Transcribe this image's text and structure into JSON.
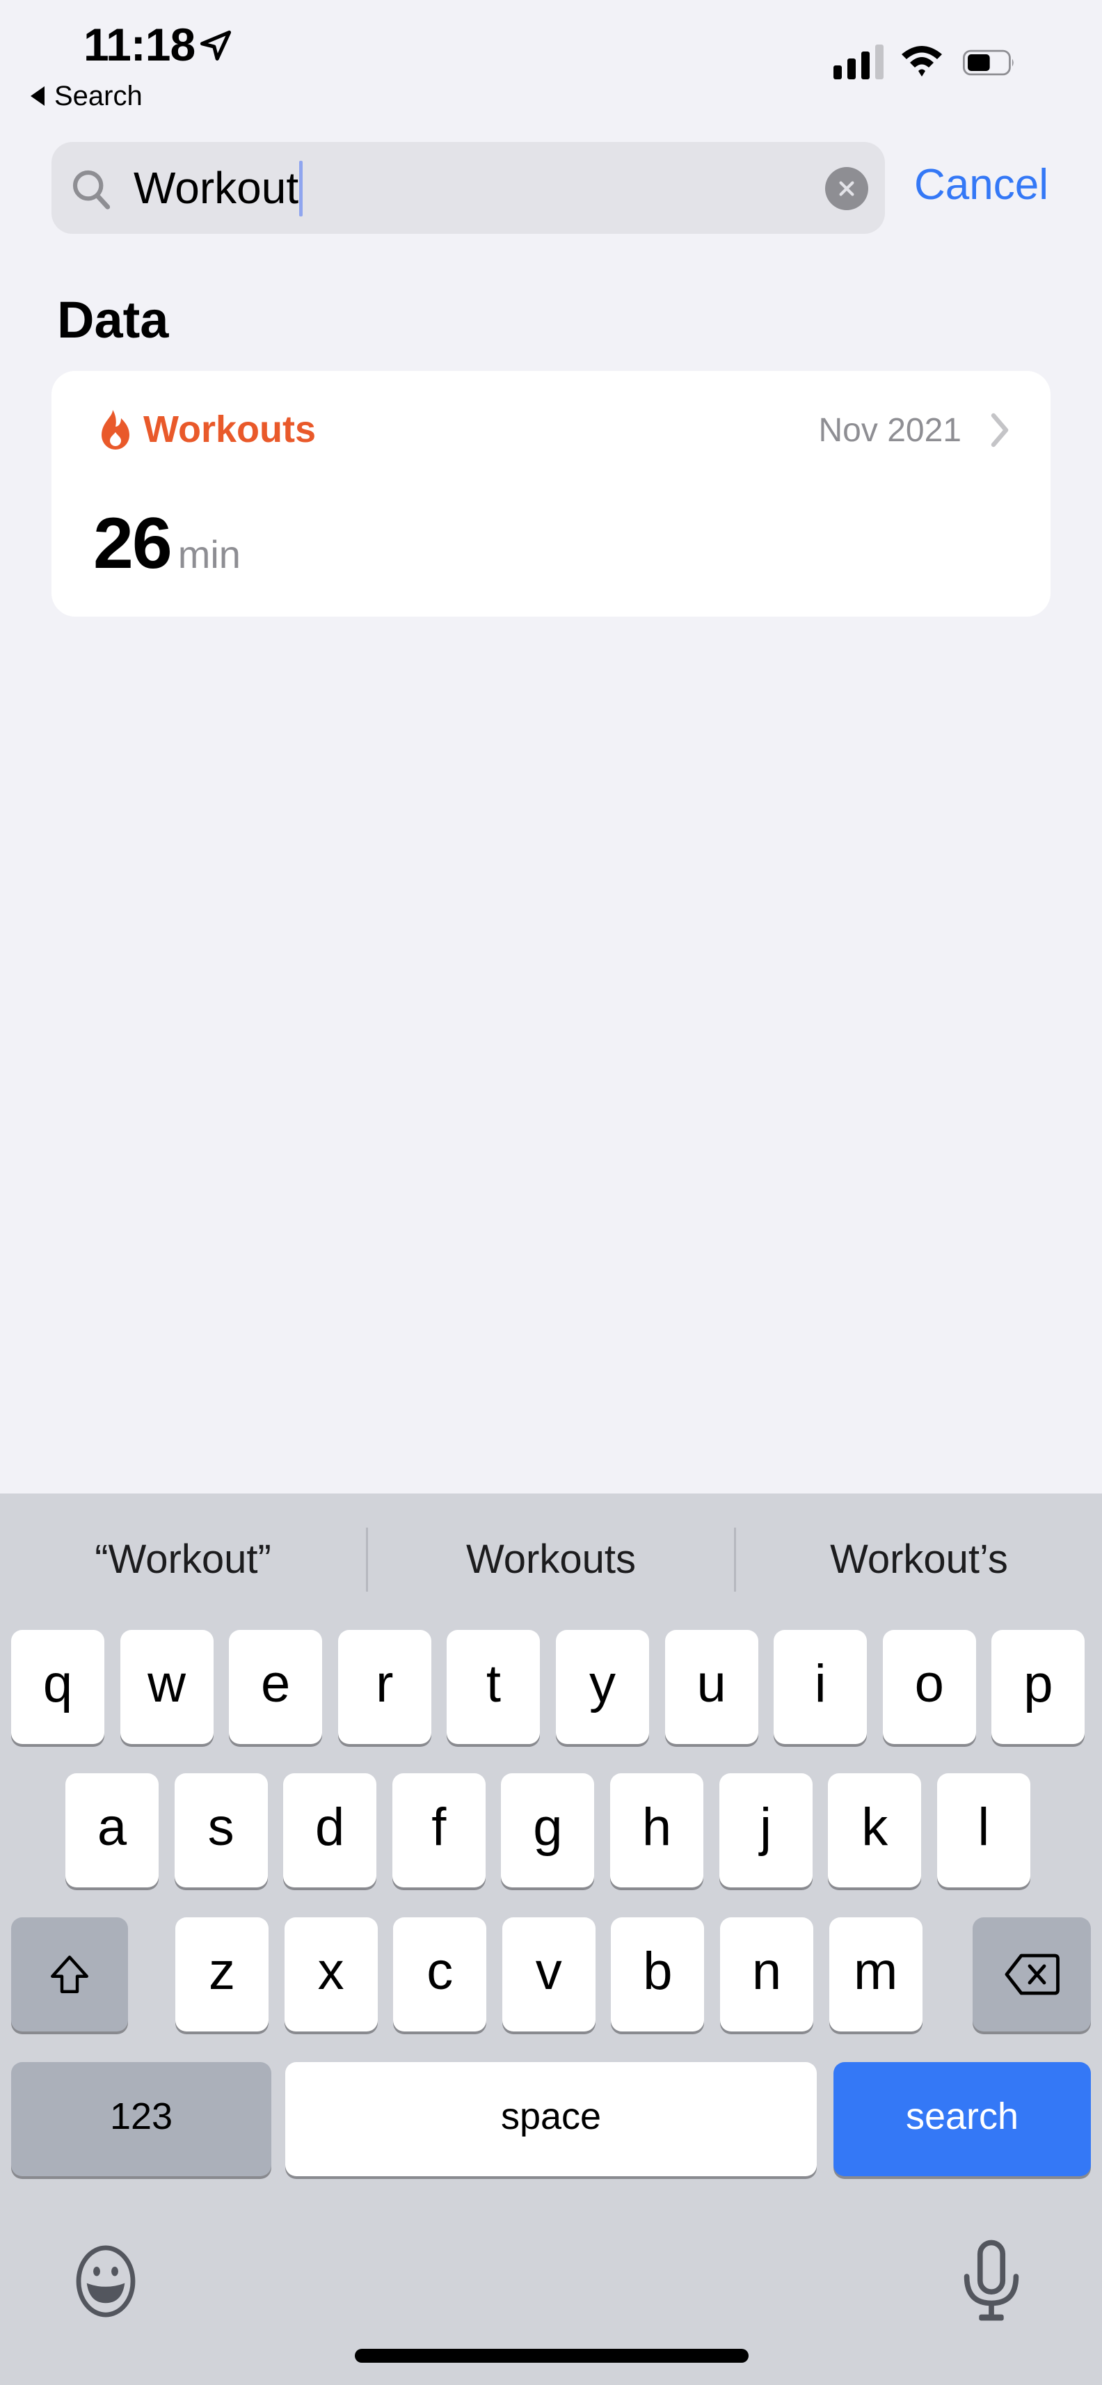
{
  "status_bar": {
    "time": "11:18",
    "back_label": "Search",
    "icons": [
      "location-arrow-icon",
      "cellular-signal-icon",
      "wifi-icon",
      "battery-icon"
    ],
    "signal_bars_active": 3,
    "signal_bars_total": 4,
    "battery_level": 0.5
  },
  "search": {
    "value": "Workout",
    "cancel_label": "Cancel",
    "icons": {
      "leading": "magnifying-glass-icon",
      "clear": "clear-circle-x-icon"
    }
  },
  "results": {
    "section_title": "Data",
    "items": [
      {
        "icon": "flame-icon",
        "title": "Workouts",
        "date": "Nov 2021",
        "value": "26",
        "unit": "min"
      }
    ]
  },
  "colors": {
    "accent": "#3478f6",
    "workouts": "#e9592a",
    "background": "#f2f2f7",
    "keyboard": "#d1d3d9"
  },
  "keyboard": {
    "suggestions": [
      "“Workout”",
      "Workouts",
      "Workout’s"
    ],
    "rows": [
      [
        "q",
        "w",
        "e",
        "r",
        "t",
        "y",
        "u",
        "i",
        "o",
        "p"
      ],
      [
        "a",
        "s",
        "d",
        "f",
        "g",
        "h",
        "j",
        "k",
        "l"
      ],
      [
        "z",
        "x",
        "c",
        "v",
        "b",
        "n",
        "m"
      ]
    ],
    "shift_icon": "shift-arrow-icon",
    "delete_icon": "backspace-icon",
    "numbers_label": "123",
    "space_label": "space",
    "return_label": "search",
    "emoji_icon": "emoji-face-icon",
    "mic_icon": "microphone-icon"
  }
}
